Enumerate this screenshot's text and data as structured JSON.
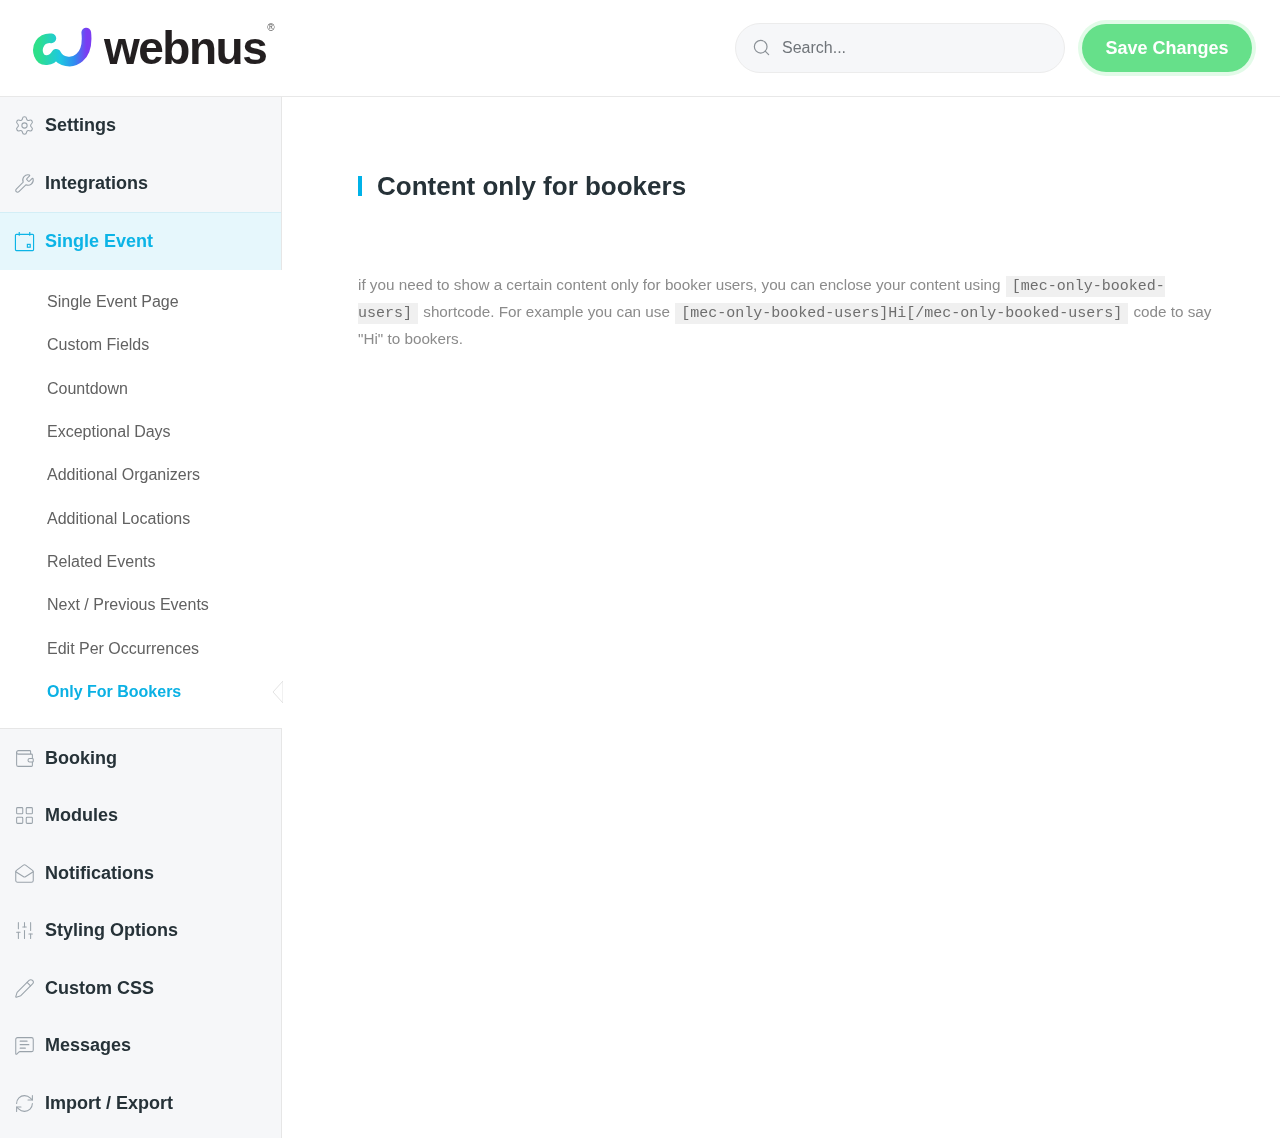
{
  "header": {
    "logo": {
      "wordmark": "webnus",
      "registered": "®"
    },
    "search": {
      "placeholder": "Search..."
    },
    "save_button": {
      "label": "Save Changes"
    }
  },
  "sidebar": {
    "items": [
      {
        "label": "Settings",
        "selected": false
      },
      {
        "label": "Integrations",
        "selected": false
      },
      {
        "label": "Single Event",
        "selected": true,
        "children": [
          {
            "label": "Single Event Page",
            "selected": false
          },
          {
            "label": "Custom Fields",
            "selected": false
          },
          {
            "label": "Countdown",
            "selected": false
          },
          {
            "label": "Exceptional Days",
            "selected": false
          },
          {
            "label": "Additional Organizers",
            "selected": false
          },
          {
            "label": "Additional Locations",
            "selected": false
          },
          {
            "label": "Related Events",
            "selected": false
          },
          {
            "label": "Next / Previous Events",
            "selected": false
          },
          {
            "label": "Edit Per Occurrences",
            "selected": false
          },
          {
            "label": "Only For Bookers",
            "selected": true
          }
        ]
      },
      {
        "label": "Booking",
        "selected": false
      },
      {
        "label": "Modules",
        "selected": false
      },
      {
        "label": "Notifications",
        "selected": false
      },
      {
        "label": "Styling Options",
        "selected": false
      },
      {
        "label": "Custom CSS",
        "selected": false
      },
      {
        "label": "Messages",
        "selected": false
      },
      {
        "label": "Import / Export",
        "selected": false
      }
    ]
  },
  "content": {
    "title": "Content only for bookers",
    "paragraph": [
      {
        "kind": "text",
        "text": "if you need to show a certain content only for booker users, you can enclose your content using "
      },
      {
        "kind": "code",
        "text": "[mec-only-booked-users]"
      },
      {
        "kind": "text",
        "text": " shortcode. For example you can use "
      },
      {
        "kind": "code",
        "text": "[mec-only-booked-users]Hi[/mec-only-booked-users]"
      },
      {
        "kind": "text",
        "text": " code to say \"Hi\" to bookers."
      }
    ]
  }
}
